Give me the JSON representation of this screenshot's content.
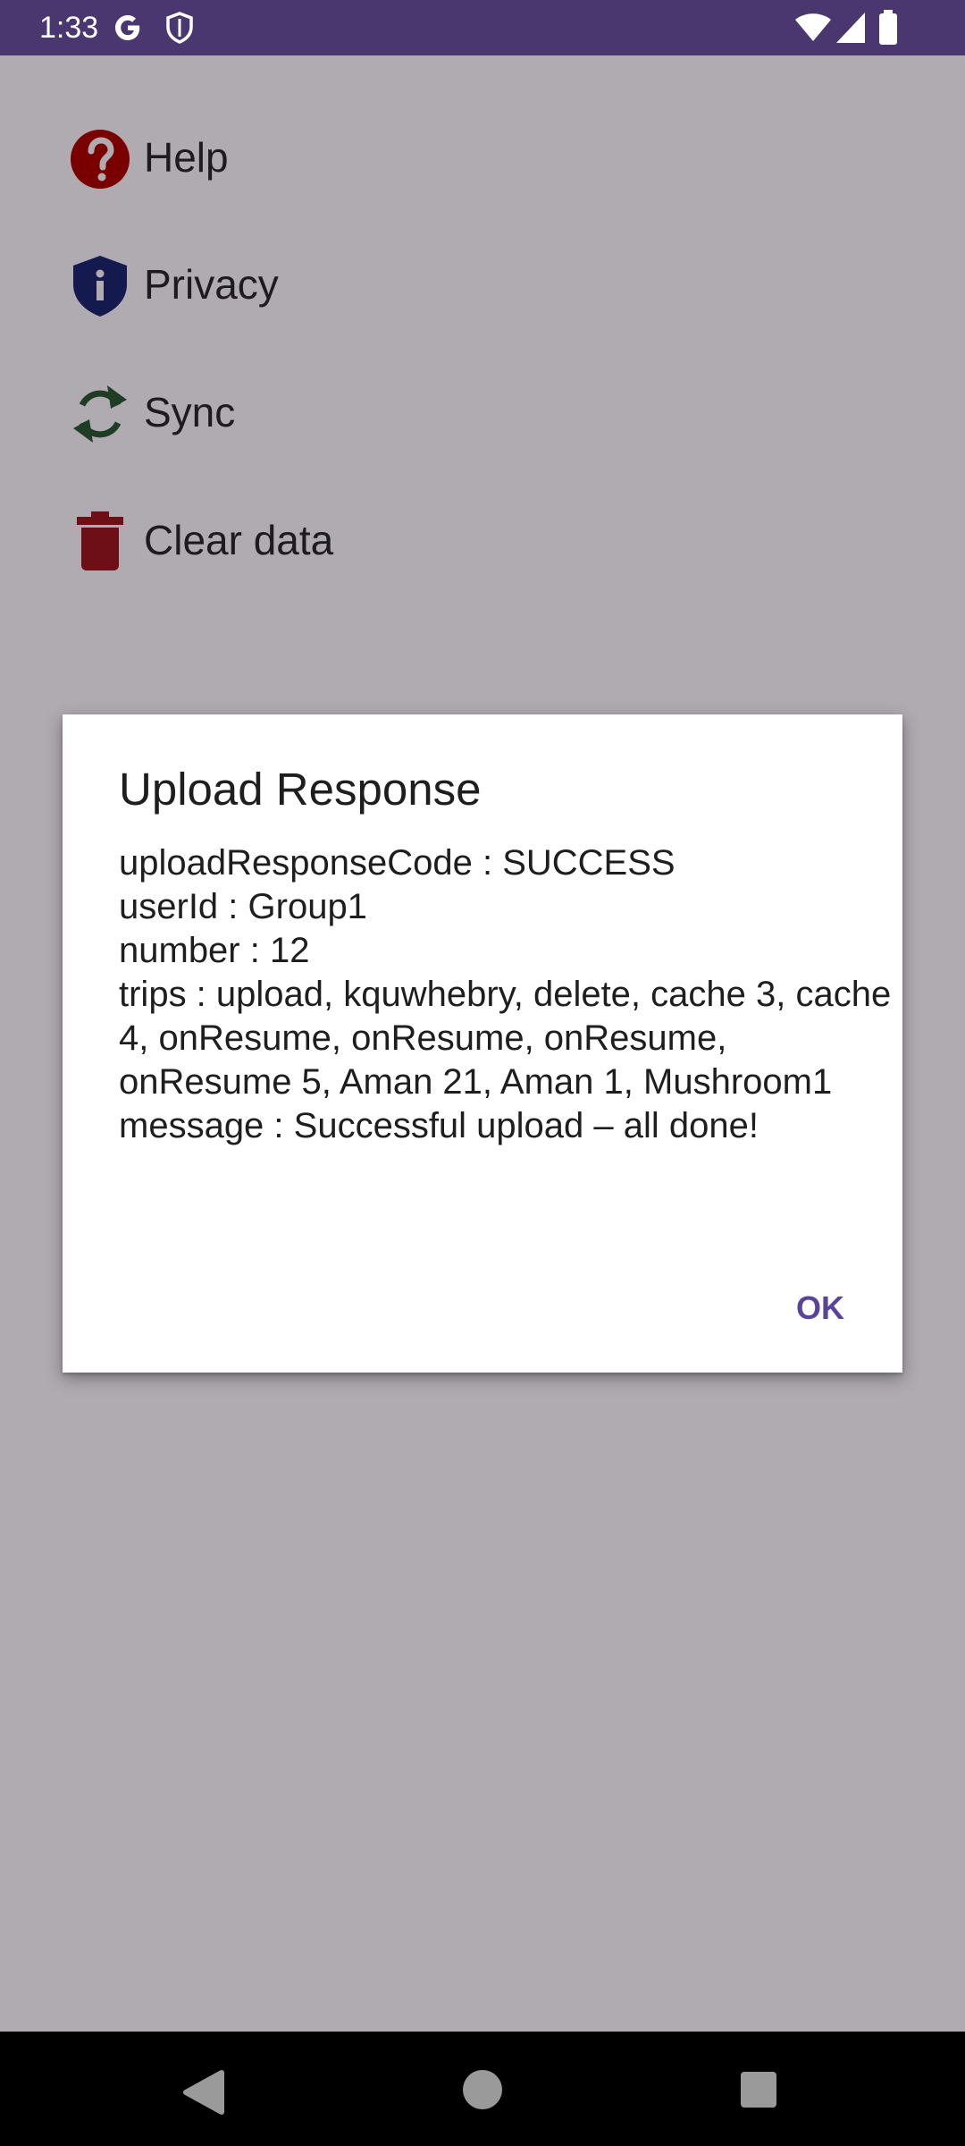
{
  "status_bar": {
    "time": "1:33",
    "icons": [
      "google-icon",
      "shield-icon",
      "wifi-icon",
      "signal-icon",
      "battery-icon"
    ],
    "background": "#4a376f"
  },
  "menu": {
    "items": [
      {
        "label": "Help",
        "icon": "help-icon",
        "color": "#7a0000"
      },
      {
        "label": "Privacy",
        "icon": "privacy-shield-icon",
        "color": "#141a4e"
      },
      {
        "label": "Sync",
        "icon": "sync-icon",
        "color": "#1e3d24"
      },
      {
        "label": "Clear data",
        "icon": "trash-icon",
        "color": "#6e0e17"
      }
    ]
  },
  "dialog": {
    "title": "Upload Response",
    "lines": [
      "uploadResponseCode : SUCCESS",
      "userId : Group1",
      "number : 12",
      "trips : upload, kquwhebry, delete, cache 3, cache 4, onResume, onResume, onResume, onResume 5, Aman 21, Aman 1, Mushroom1",
      "message : Successful upload – all done!"
    ],
    "ok_label": "OK",
    "accent": "#5a449b"
  },
  "nav_bar": {
    "buttons": [
      "back-icon",
      "home-icon",
      "recents-icon"
    ]
  }
}
